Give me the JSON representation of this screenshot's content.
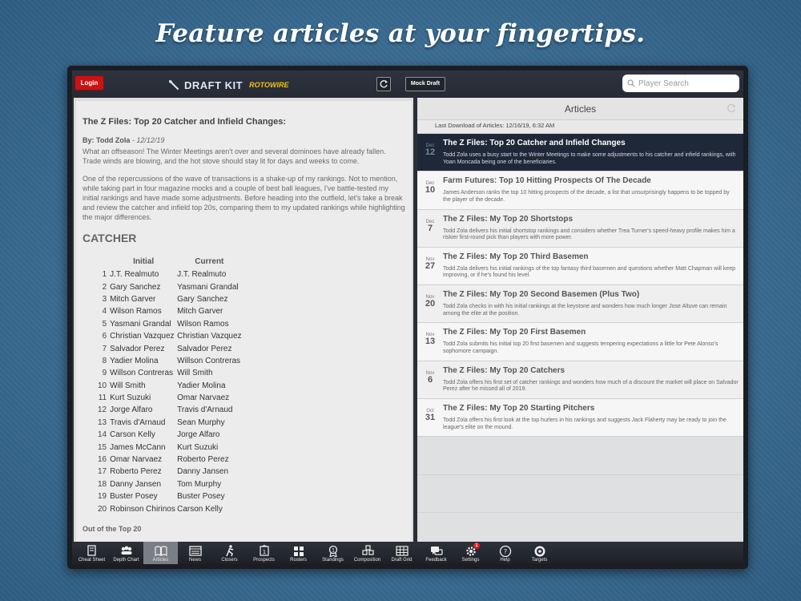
{
  "headline": "Feature articles at your fingertips.",
  "topbar": {
    "login_label": "Login",
    "brand_name": "DRAFT KIT",
    "brand_sub": "ROTOWIRE",
    "mock_draft_label": "Mock Draft",
    "search_placeholder": "Player Search"
  },
  "article": {
    "title": "The Z Files: Top 20 Catcher and Infield Changes:",
    "byline_prefix": "By: Todd Zola",
    "byline_date": "- 12/12/19",
    "paragraphs": [
      "What an offseason! The Winter Meetings aren't over and several dominoes have already fallen. Trade winds are blowing, and the hot stove should stay lit for days and weeks to come.",
      "One of the repercussions of the wave of transactions is a shake-up of my rankings. Not to mention, while taking part in four magazine mocks and a couple of best ball leagues, I've battle-tested my initial rankings and have made some adjustments. Before heading into the outfield, let's take a break and review the catcher and infield top 20s, comparing them to my updated rankings while highlighting the major differences."
    ],
    "section_heading": "CATCHER",
    "table_headers": {
      "initial": "Initial",
      "current": "Current"
    },
    "rankings": [
      {
        "rank": "1",
        "initial": "J.T. Realmuto",
        "current": "J.T. Realmuto"
      },
      {
        "rank": "2",
        "initial": "Gary Sanchez",
        "current": "Yasmani Grandal"
      },
      {
        "rank": "3",
        "initial": "Mitch Garver",
        "current": "Gary Sanchez"
      },
      {
        "rank": "4",
        "initial": "Wilson Ramos",
        "current": "Mitch Garver"
      },
      {
        "rank": "5",
        "initial": "Yasmani Grandal",
        "current": "Wilson Ramos"
      },
      {
        "rank": "6",
        "initial": "Christian Vazquez",
        "current": "Christian Vazquez"
      },
      {
        "rank": "7",
        "initial": "Salvador Perez",
        "current": "Salvador Perez"
      },
      {
        "rank": "8",
        "initial": "Yadier Molina",
        "current": "Willson Contreras"
      },
      {
        "rank": "9",
        "initial": "Willson Contreras",
        "current": "Will Smith"
      },
      {
        "rank": "10",
        "initial": "Will Smith",
        "current": "Yadier Molina"
      },
      {
        "rank": "11",
        "initial": "Kurt Suzuki",
        "current": "Omar Narvaez"
      },
      {
        "rank": "12",
        "initial": "Jorge Alfaro",
        "current": "Travis d'Arnaud"
      },
      {
        "rank": "13",
        "initial": "Travis d'Arnaud",
        "current": "Sean Murphy"
      },
      {
        "rank": "14",
        "initial": "Carson Kelly",
        "current": "Jorge Alfaro"
      },
      {
        "rank": "15",
        "initial": "James McCann",
        "current": "Kurt Suzuki"
      },
      {
        "rank": "16",
        "initial": "Omar Narvaez",
        "current": "Roberto Perez"
      },
      {
        "rank": "17",
        "initial": "Roberto Perez",
        "current": "Danny Jansen"
      },
      {
        "rank": "18",
        "initial": "Danny Jansen",
        "current": "Tom Murphy"
      },
      {
        "rank": "19",
        "initial": "Buster Posey",
        "current": "Buster Posey"
      },
      {
        "rank": "20",
        "initial": "Robinson Chirinos",
        "current": "Carson Kelly"
      }
    ],
    "out_of_top": "Out of the Top 20"
  },
  "articles_list": {
    "title": "Articles",
    "last_download": "Last Download of Articles: 12/16/19, 6:32 AM",
    "items": [
      {
        "mon": "Dec",
        "day": "12",
        "title": "The Z Files: Top 20 Catcher and Infield Changes",
        "desc": "Todd Zola uses a busy start to the Winter Meetings to make some adjustments to his catcher and infield rankings, with Yoan Moncada being one of the beneficiaries."
      },
      {
        "mon": "Dec",
        "day": "10",
        "title": "Farm Futures: Top 10 Hitting Prospects Of The Decade",
        "desc": "James Anderson ranks the top 10 hitting prospects of the decade, a list that unsurprisingly happens to be topped by the player of the decade."
      },
      {
        "mon": "Dec",
        "day": "7",
        "title": "The Z Files: My Top 20 Shortstops",
        "desc": "Todd Zola delivers his initial shortstop rankings and considers whether Trea Turner's speed-heavy profile makes him a riskier first-round pick than players with more power."
      },
      {
        "mon": "Nov",
        "day": "27",
        "title": "The Z Files: My Top 20 Third Basemen",
        "desc": "Todd Zola delivers his initial rankings of the top fantasy third basemen and questions whether Matt Chapman will keep improving, or if he's found his level."
      },
      {
        "mon": "Nov",
        "day": "20",
        "title": "The Z Files: My Top 20 Second Basemen (Plus Two)",
        "desc": "Todd Zola checks in with his initial rankings at the keystone and wonders how much longer Jose Altuve can remain among the elite at the position."
      },
      {
        "mon": "Nov",
        "day": "13",
        "title": "The Z Files: My Top 20 First Basemen",
        "desc": "Todd Zola submits his initial top 20 first basemen and suggests tempering expectations a little for Pete Alonso's sophomore campaign."
      },
      {
        "mon": "Nov",
        "day": "6",
        "title": "The Z Files: My Top 20 Catchers",
        "desc": "Todd Zola offers his first set of catcher rankings and wonders how much of a discount the market will place on Salvador Perez after he missed all of 2019."
      },
      {
        "mon": "Oct",
        "day": "31",
        "title": "The Z Files: My Top 20 Starting Pitchers",
        "desc": "Todd Zola offers his first look at the top hurlers in his rankings and suggests Jack Flaherty may be ready to join the league's elite on the mound."
      }
    ]
  },
  "tabs": [
    {
      "label": "Cheat Sheet",
      "icon": "cheat-sheet-icon"
    },
    {
      "label": "Depth Chart",
      "icon": "depth-chart-icon"
    },
    {
      "label": "Articles",
      "icon": "articles-icon",
      "active": true
    },
    {
      "label": "News",
      "icon": "news-icon"
    },
    {
      "label": "Closers",
      "icon": "closers-icon"
    },
    {
      "label": "Prospects",
      "icon": "prospects-icon"
    },
    {
      "label": "Rosters",
      "icon": "rosters-icon"
    },
    {
      "label": "Standings",
      "icon": "standings-icon"
    },
    {
      "label": "Composition",
      "icon": "composition-icon"
    },
    {
      "label": "Draft Grid",
      "icon": "draft-grid-icon"
    },
    {
      "label": "Feedback",
      "icon": "feedback-icon"
    },
    {
      "label": "Settings",
      "icon": "settings-icon",
      "badge": "1"
    },
    {
      "label": "Help",
      "icon": "help-icon"
    },
    {
      "label": "Targets",
      "icon": "targets-icon"
    }
  ],
  "colors": {
    "accent_red": "#c81414",
    "selected_row": "#1e2838",
    "brand_yellow": "#f2c21b"
  }
}
